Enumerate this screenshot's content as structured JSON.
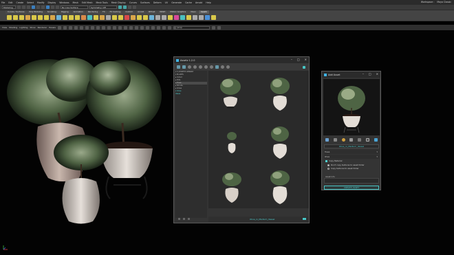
{
  "menubar": {
    "items": [
      "File",
      "Edit",
      "Create",
      "Select",
      "Modify",
      "Display",
      "Windows",
      "Mesh",
      "Edit Mesh",
      "Mesh Tools",
      "Mesh Display",
      "Curves",
      "Surfaces",
      "Deform",
      "UV",
      "Generate",
      "Cache",
      "Arnold",
      "Help"
    ],
    "workspace_label": "Workspace :",
    "workspace_value": "Maya Classic"
  },
  "statusline": {
    "mode": "Modeling",
    "symmetry": "No Live Surface",
    "symmetry_state": "Symmetry: Off"
  },
  "shelf_tabs": [
    "Curves / Surfaces",
    "Poly Modeling",
    "Sculpting",
    "Rigging",
    "Animation",
    "Rendering",
    "FX",
    "FX Caching",
    "Custom",
    "Arnold",
    "Bifrost",
    "MASH",
    "Motion Graphics",
    "XGen",
    "Assetz"
  ],
  "shelf_active_tab": "Assetz",
  "viewport_menu": [
    "View",
    "Shading",
    "Lighting",
    "Show",
    "Renderer",
    "Panels"
  ],
  "camera_value": "persp",
  "assetz_window": {
    "title": "Assetz 1.2.0",
    "tree": [
      {
        "label": "▾ C:/ASSETZ LIBRARY",
        "selected": false,
        "teal": false
      },
      {
        "label": "  ▾ PLANTS",
        "selected": false,
        "teal": false
      },
      {
        "label": "    ▸ Indoor",
        "selected": false,
        "teal": false
      },
      {
        "label": "    ▸ Pots",
        "selected": false,
        "teal": false
      },
      {
        "label": "    ▸ Trees",
        "selected": true,
        "teal": false
      },
      {
        "label": "    ▸ Shrubs",
        "selected": false,
        "teal": false
      },
      {
        "label": "    ▸ Grass",
        "selected": false,
        "teal": false
      },
      {
        "label": "▾ Olive",
        "selected": false,
        "teal": true
      },
      {
        "label": "  Vases",
        "selected": false,
        "teal": true
      }
    ],
    "selected_asset": "Olive_in_Medium_Vessel"
  },
  "add_asset_window": {
    "title": "Add Asset",
    "asset_name": "Olive_in_Medium_Vessel",
    "category": "Trees",
    "subcategory": "Olive",
    "copy_material_label": "Copy Material",
    "copy_material_checked": true,
    "radio_dont_copy": "Don't copy textures to asset folder",
    "radio_copy": "Copy textures to asset folder",
    "asset_info_label": "Asset Info",
    "create_button": "CREATE ASSET"
  },
  "colors": {
    "accent": "#47c6c6",
    "window_bg": "#343434",
    "titlebar": "#2b2b2b"
  }
}
